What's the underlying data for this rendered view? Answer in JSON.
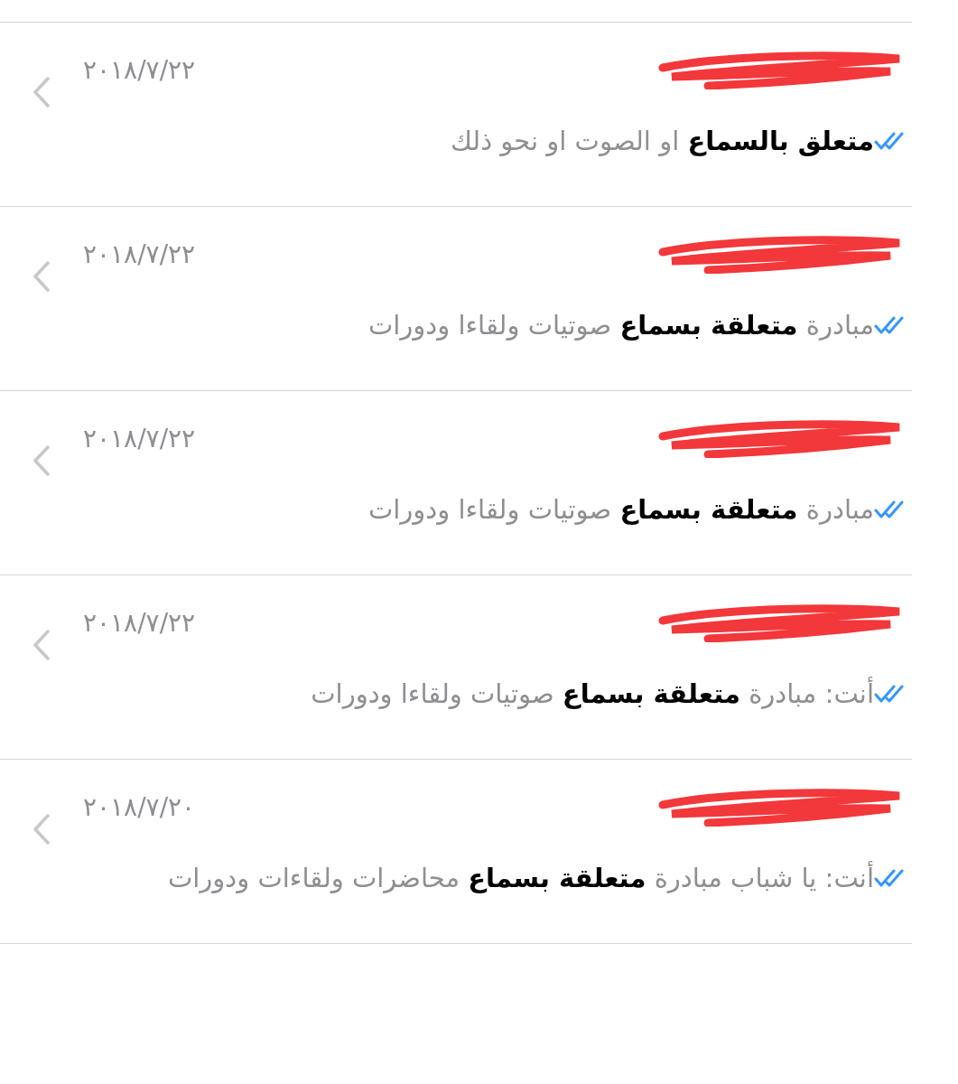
{
  "results": [
    {
      "date": "٢٠١٨/٧/٢٢",
      "message": "**متعلق بالسماع** او الصوت او نحو ذلك"
    },
    {
      "date": "٢٠١٨/٧/٢٢",
      "message": "مبادرة **متعلقة بسماع** صوتيات ولقاءا ودورات"
    },
    {
      "date": "٢٠١٨/٧/٢٢",
      "message": "مبادرة **متعلقة بسماع** صوتيات ولقاءا ودورات"
    },
    {
      "date": "٢٠١٨/٧/٢٢",
      "message": "أنت: مبادرة **متعلقة بسماع** صوتيات ولقاءا ودورات"
    },
    {
      "date": "٢٠١٨/٧/٢٠",
      "message": "أنت: يا شباب مبادرة **متعلقة بسماع** محاضرات ولقاءات ودورات"
    }
  ]
}
